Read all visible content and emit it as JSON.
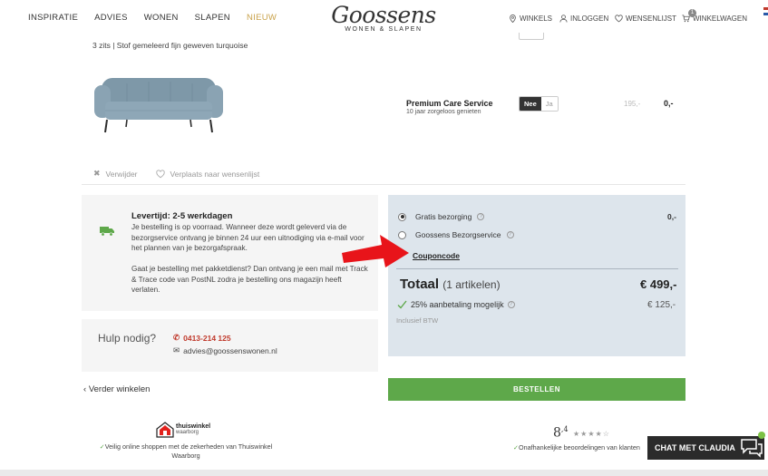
{
  "header": {
    "nav": [
      "INSPIRATIE",
      "ADVIES",
      "WONEN",
      "SLAPEN",
      "NIEUW"
    ],
    "logo_script": "Goossens",
    "logo_sub": "WONEN & SLAPEN",
    "winkels": "WINKELS",
    "inloggen": "INLOGGEN",
    "wensenlijst": "WENSENLIJST",
    "winkelwagen": "WINKELWAGEN",
    "cart_count": "1"
  },
  "product": {
    "description": "3 zits | Stof gemeleerd fijn geweven turquoise",
    "care_title": "Premium Care Service",
    "care_sub": "10 jaar zorgeloos genieten",
    "toggle_no": "Nee",
    "toggle_yes": "Ja",
    "care_price_strike": "195,-",
    "care_price": "0,-",
    "remove": "Verwijder",
    "move_wishlist": "Verplaats naar wensenlijst"
  },
  "delivery": {
    "title": "Levertijd: 2-5 werkdagen",
    "text1": "Je bestelling is op voorraad. Wanneer deze wordt geleverd via de bezorgservice ontvang je binnen 24 uur een uitnodiging via e-mail voor het plannen van je bezorgafspraak.",
    "text2": "Gaat je bestelling met pakketdienst? Dan ontvang je een mail met Track & Trace code van PostNL zodra je bestelling ons magazijn heeft verlaten."
  },
  "help": {
    "label": "Hulp nodig?",
    "phone": "0413-214 125",
    "email": "advies@goossenswonen.nl"
  },
  "back_link": "Verder winkelen",
  "summary": {
    "ship_free": "Gratis bezorging",
    "ship_service": "Goossens Bezorgservice",
    "ship_price": "0,-",
    "coupon": "Couponcode",
    "total_label": "Totaal",
    "total_items": "(1 artikelen)",
    "total_value": "€ 499,-",
    "deposit_label": "25% aanbetaling mogelijk",
    "deposit_value": "€ 125,-",
    "btw": "Inclusief BTW",
    "order_button": "BESTELLEN"
  },
  "trust": {
    "tw_name": "thuiswinkel",
    "tw_sub": "waarborg",
    "tw_text": "Veilig online shoppen met de zekerheden van Thuiswinkel Waarborg",
    "rating_main": "8",
    "rating_dec": ",4",
    "stars": "★★★★☆",
    "rating_text": "Onafhankelijke beoordelingen van klanten"
  },
  "chat": {
    "label": "CHAT MET CLAUDIA"
  },
  "colors": {
    "accent_green": "#5ea84a",
    "summary_bg": "#dde5ec",
    "phone_red": "#c0392b",
    "nieuw_gold": "#c9a24b",
    "arrow_red": "#e8141a"
  }
}
